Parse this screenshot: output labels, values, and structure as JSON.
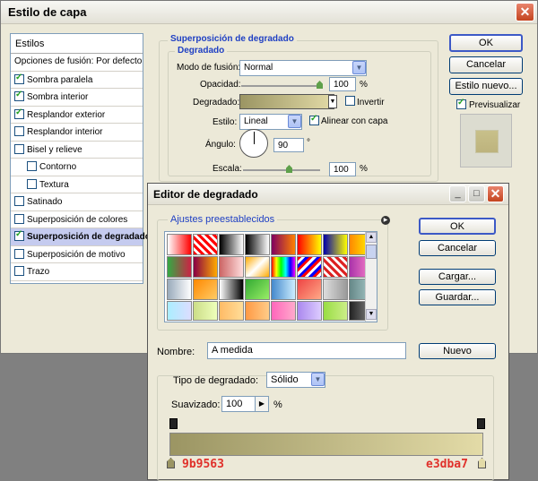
{
  "layer_style": {
    "title": "Estilo de capa",
    "styles_header": "Estilos",
    "blend_default": "Opciones de fusión: Por defecto",
    "items": [
      {
        "label": "Sombra paralela",
        "checked": true
      },
      {
        "label": "Sombra interior",
        "checked": true
      },
      {
        "label": "Resplandor exterior",
        "checked": true
      },
      {
        "label": "Resplandor interior",
        "checked": false
      },
      {
        "label": "Bisel y relieve",
        "checked": false
      },
      {
        "label": "Contorno",
        "checked": false
      },
      {
        "label": "Textura",
        "checked": false
      },
      {
        "label": "Satinado",
        "checked": false
      },
      {
        "label": "Superposición de colores",
        "checked": false
      },
      {
        "label": "Superposición de degradado",
        "checked": true,
        "selected": true
      },
      {
        "label": "Superposición de motivo",
        "checked": false
      },
      {
        "label": "Trazo",
        "checked": false
      }
    ],
    "section_title": "Superposición de degradado",
    "group_title": "Degradado",
    "blend_mode_label": "Modo de fusión:",
    "blend_mode_value": "Normal",
    "opacity_label": "Opacidad:",
    "opacity_value": "100",
    "opacity_unit": "%",
    "gradient_label": "Degradado:",
    "invert_label": "Invertir",
    "style_label": "Estilo:",
    "style_value": "Lineal",
    "align_label": "Alinear con capa",
    "angle_label": "Ángulo:",
    "angle_value": "90",
    "angle_unit": "°",
    "scale_label": "Escala:",
    "scale_value": "100",
    "scale_unit": "%",
    "ok": "OK",
    "cancel": "Cancelar",
    "new_style": "Estilo nuevo...",
    "preview_label": "Previsualizar",
    "preview_checked": true
  },
  "gradient_editor": {
    "title": "Editor de degradado",
    "presets_label": "Ajustes preestablecidos",
    "ok": "OK",
    "cancel": "Cancelar",
    "load": "Cargar...",
    "save": "Guardar...",
    "name_label": "Nombre:",
    "name_value": "A medida",
    "new": "Nuevo",
    "type_label": "Tipo de degradado:",
    "type_value": "Sólido",
    "smooth_label": "Suavizado:",
    "smooth_value": "100",
    "smooth_unit": "%",
    "stop_left_color": "9b9563",
    "stop_right_color": "e3dba7"
  },
  "colors": {
    "gradient_start": "#9b9563",
    "gradient_end": "#e3dba7",
    "accent_blue": "#1e3fc3",
    "hex_label_red": "#e0302a"
  }
}
